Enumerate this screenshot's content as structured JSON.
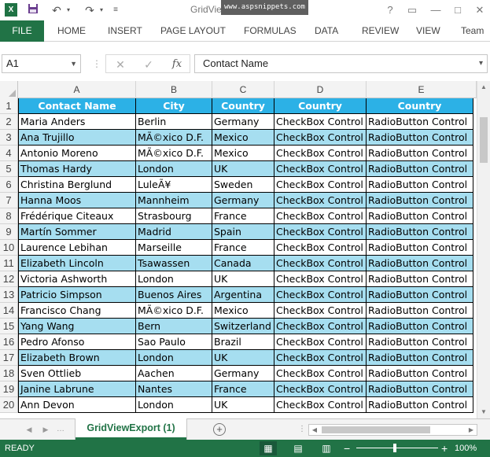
{
  "window": {
    "title": "GridViewExport (1) - Excel",
    "watermark": "www.aspsnippets.com",
    "help_icon": "?",
    "app_logo": "X"
  },
  "ribbon": {
    "file_tab": "FILE",
    "tabs": [
      "HOME",
      "INSERT",
      "PAGE LAYOUT",
      "FORMULAS",
      "DATA",
      "REVIEW",
      "VIEW",
      "Team"
    ]
  },
  "formula_bar": {
    "name_box": "A1",
    "fx_label": "fx",
    "formula": "Contact Name"
  },
  "grid": {
    "columns": [
      "A",
      "B",
      "C",
      "D",
      "E"
    ],
    "header_row": {
      "row_number": "1",
      "cells": [
        "Contact Name",
        "City",
        "Country",
        "Country",
        "Country"
      ]
    },
    "rows": [
      {
        "row_number": "2",
        "cells": [
          "Maria Anders",
          "Berlin",
          "Germany",
          "CheckBox Control",
          "RadioButton Control"
        ]
      },
      {
        "row_number": "3",
        "cells": [
          "Ana Trujillo",
          "MÃ©xico D.F.",
          "Mexico",
          "CheckBox Control",
          "RadioButton Control"
        ]
      },
      {
        "row_number": "4",
        "cells": [
          "Antonio Moreno",
          "MÃ©xico D.F.",
          "Mexico",
          "CheckBox Control",
          "RadioButton Control"
        ]
      },
      {
        "row_number": "5",
        "cells": [
          "Thomas Hardy",
          "London",
          "UK",
          "CheckBox Control",
          "RadioButton Control"
        ]
      },
      {
        "row_number": "6",
        "cells": [
          "Christina Berglund",
          "LuleÃ¥",
          "Sweden",
          "CheckBox Control",
          "RadioButton Control"
        ]
      },
      {
        "row_number": "7",
        "cells": [
          "Hanna Moos",
          "Mannheim",
          "Germany",
          "CheckBox Control",
          "RadioButton Control"
        ]
      },
      {
        "row_number": "8",
        "cells": [
          "Frédérique Citeaux",
          "Strasbourg",
          "France",
          "CheckBox Control",
          "RadioButton Control"
        ]
      },
      {
        "row_number": "9",
        "cells": [
          "Martín Sommer",
          "Madrid",
          "Spain",
          "CheckBox Control",
          "RadioButton Control"
        ]
      },
      {
        "row_number": "10",
        "cells": [
          "Laurence Lebihan",
          "Marseille",
          "France",
          "CheckBox Control",
          "RadioButton Control"
        ]
      },
      {
        "row_number": "11",
        "cells": [
          "Elizabeth Lincoln",
          "Tsawassen",
          "Canada",
          "CheckBox Control",
          "RadioButton Control"
        ]
      },
      {
        "row_number": "12",
        "cells": [
          "Victoria Ashworth",
          "London",
          "UK",
          "CheckBox Control",
          "RadioButton Control"
        ]
      },
      {
        "row_number": "13",
        "cells": [
          "Patricio Simpson",
          "Buenos Aires",
          "Argentina",
          "CheckBox Control",
          "RadioButton Control"
        ]
      },
      {
        "row_number": "14",
        "cells": [
          "Francisco Chang",
          "MÃ©xico D.F.",
          "Mexico",
          "CheckBox Control",
          "RadioButton Control"
        ]
      },
      {
        "row_number": "15",
        "cells": [
          "Yang Wang",
          "Bern",
          "Switzerland",
          "CheckBox Control",
          "RadioButton Control"
        ]
      },
      {
        "row_number": "16",
        "cells": [
          "Pedro Afonso",
          "Sao Paulo",
          "Brazil",
          "CheckBox Control",
          "RadioButton Control"
        ]
      },
      {
        "row_number": "17",
        "cells": [
          "Elizabeth Brown",
          "London",
          "UK",
          "CheckBox Control",
          "RadioButton Control"
        ]
      },
      {
        "row_number": "18",
        "cells": [
          "Sven Ottlieb",
          "Aachen",
          "Germany",
          "CheckBox Control",
          "RadioButton Control"
        ]
      },
      {
        "row_number": "19",
        "cells": [
          "Janine Labrune",
          "Nantes",
          "France",
          "CheckBox Control",
          "RadioButton Control"
        ]
      },
      {
        "row_number": "20",
        "cells": [
          "Ann Devon",
          "London",
          "UK",
          "CheckBox Control",
          "RadioButton Control"
        ]
      }
    ]
  },
  "sheet_tabs": {
    "active": "GridViewExport (1)",
    "add_icon": "+"
  },
  "status_bar": {
    "status": "READY",
    "zoom": "100%",
    "zoom_minus": "−",
    "zoom_plus": "+"
  },
  "icons": {
    "app": "excel-logo-icon",
    "save": "save-icon",
    "undo": "undo-icon",
    "redo": "redo-icon",
    "customize": "customize-quick-access-icon"
  },
  "colors": {
    "excel_green": "#217346",
    "header_blue": "#2cb1e6",
    "alt_row_blue": "#a6def0"
  }
}
